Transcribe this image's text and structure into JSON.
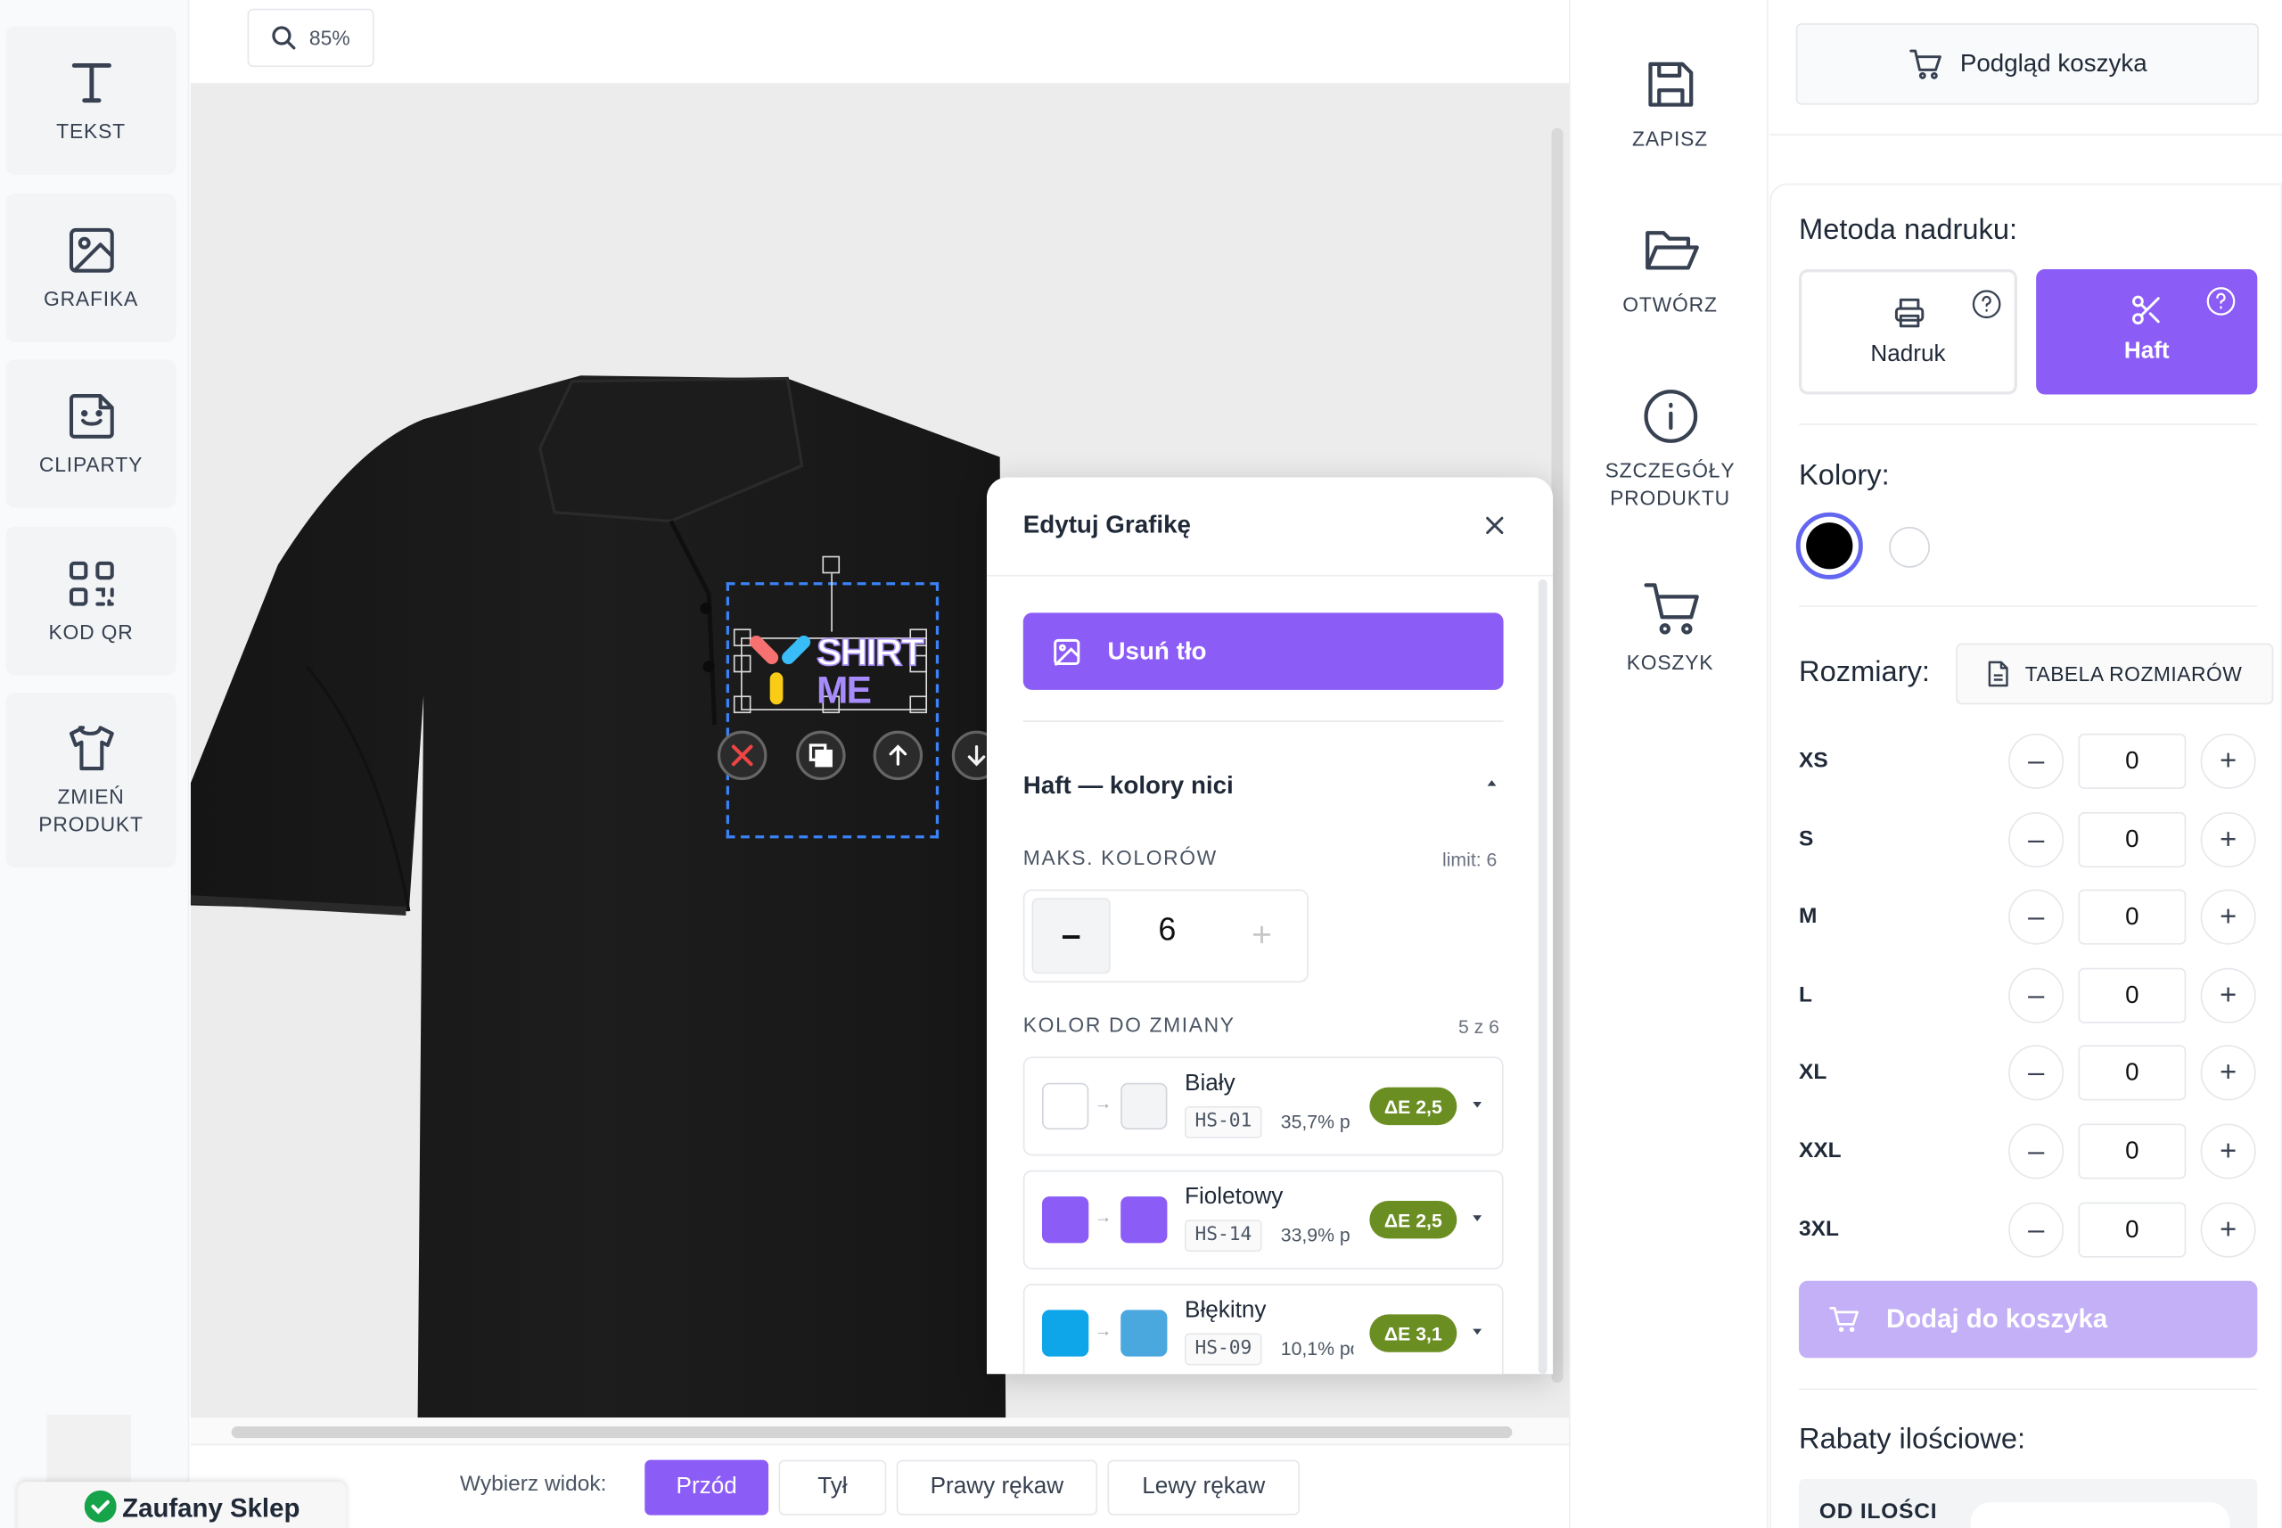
{
  "toolbar_left": [
    {
      "label": "TEKST",
      "icon": "text-icon"
    },
    {
      "label": "GRAFIKA",
      "icon": "image-icon"
    },
    {
      "label": "CLIPARTY",
      "icon": "sticker-icon"
    },
    {
      "label": "KOD QR",
      "icon": "qr-icon"
    },
    {
      "label": "ZMIEŃ PRODUKT",
      "icon": "tshirt-icon"
    }
  ],
  "zoom": {
    "value": "85%"
  },
  "design_text": {
    "line1": "SHIRT",
    "line2": "ME"
  },
  "edit_panel": {
    "title": "Edytuj Grafikę",
    "remove_bg_label": "Usuń tło",
    "section_title": "Haft — kolory nici",
    "max_colors_label": "MAKS. KOLORÓW",
    "limit_label": "limit: 6",
    "stepper": {
      "minus": "–",
      "value": "6",
      "plus": "+"
    },
    "color_change_label": "KOLOR DO ZMIANY",
    "color_count": "5 z 6",
    "colors": [
      {
        "name": "Biały",
        "code": "HS-01",
        "percent": "35,7% p",
        "delta": "ΔE 2,5",
        "from": "#ffffff",
        "to": "#f3f4f6"
      },
      {
        "name": "Fioletowy",
        "code": "HS-14",
        "percent": "33,9% p",
        "delta": "ΔE 2,5",
        "from": "#8b5cf6",
        "to": "#8b5cf6"
      },
      {
        "name": "Błękitny",
        "code": "HS-09",
        "percent": "10,1% po",
        "delta": "ΔE 3,1",
        "from": "#0ea5e9",
        "to": "#4aa8df"
      }
    ]
  },
  "actions": [
    {
      "label": "ZAPISZ",
      "icon": "save-icon"
    },
    {
      "label": "OTWÓRZ",
      "icon": "folder-open-icon"
    },
    {
      "label": "SZCZEGÓŁY PRODUKTU",
      "icon": "info-icon"
    },
    {
      "label": "KOSZYK",
      "icon": "cart-icon"
    }
  ],
  "panel": {
    "cart_preview_label": "Podgląd koszyka",
    "print_method_title": "Metoda nadruku:",
    "methods": [
      {
        "label": "Nadruk",
        "selected": false
      },
      {
        "label": "Haft",
        "selected": true
      }
    ],
    "colors_title": "Kolory:",
    "product_colors": [
      "#000000",
      "#ffffff"
    ],
    "sizes_title": "Rozmiary:",
    "size_table_label": "TABELA ROZMIARÓW",
    "sizes": [
      {
        "size": "XS",
        "qty": "0"
      },
      {
        "size": "S",
        "qty": "0"
      },
      {
        "size": "M",
        "qty": "0"
      },
      {
        "size": "L",
        "qty": "0"
      },
      {
        "size": "XL",
        "qty": "0"
      },
      {
        "size": "XXL",
        "qty": "0"
      },
      {
        "size": "3XL",
        "qty": "0"
      }
    ],
    "minus": "–",
    "plus": "+",
    "add_to_cart_label": "Dodaj do koszyka",
    "discounts_title": "Rabaty ilościowe:",
    "from_qty_label": "OD ILOŚCI"
  },
  "view_bar": {
    "label": "Wybierz widok:",
    "views": [
      {
        "label": "Przód",
        "active": true
      },
      {
        "label": "Tył",
        "active": false
      },
      {
        "label": "Prawy rękaw",
        "active": false
      },
      {
        "label": "Lewy rękaw",
        "active": false
      }
    ]
  },
  "trust_badge": {
    "label": "Zaufany Sklep"
  },
  "colors": {
    "accent": "#8b5cf6",
    "accent_disabled": "#c4b0f7",
    "badge": "#6b8e23"
  }
}
